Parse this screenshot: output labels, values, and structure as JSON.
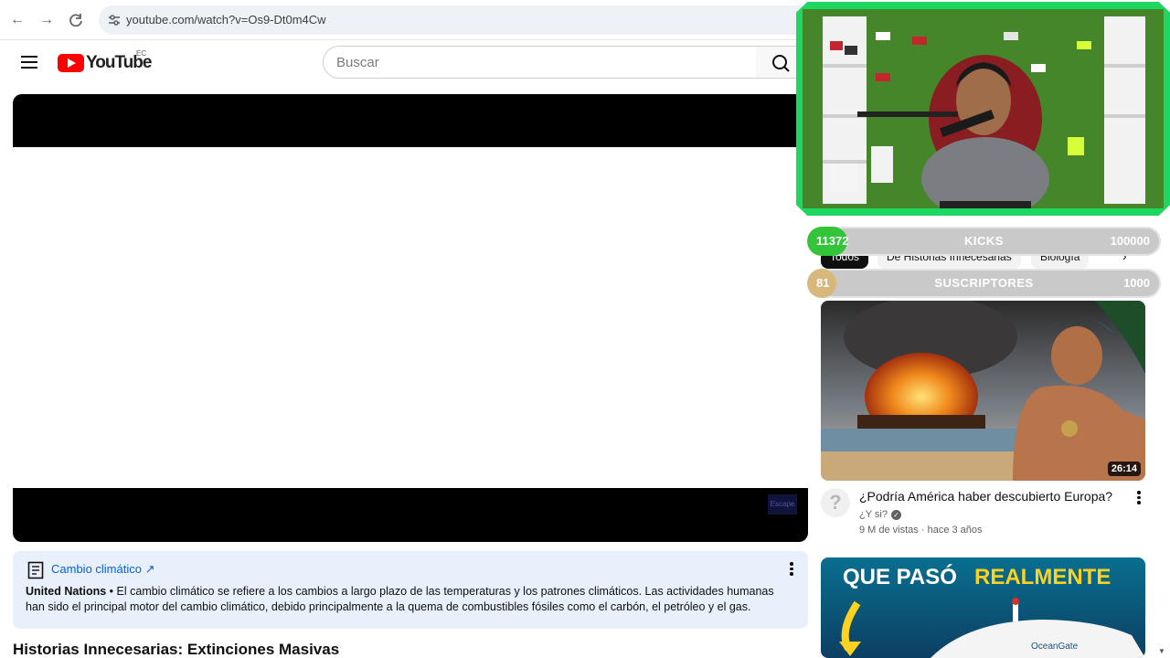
{
  "browser": {
    "url": "youtube.com/watch?v=Os9-Dt0m4Cw"
  },
  "header": {
    "logo_text": "YouTube",
    "country_code": "EC",
    "search_placeholder": "Buscar"
  },
  "player": {
    "watermark": "Escape"
  },
  "info_panel": {
    "topic": "Cambio climático",
    "source": "United Nations",
    "separator": " • ",
    "text": "El cambio climático se refiere a los cambios a largo plazo de las temperaturas y los patrones climáticos. Las actividades humanas han sido el principal motor del cambio climático, debido principalmente a la quema de combustibles fósiles como el carbón, el petróleo y el gas."
  },
  "video": {
    "title": "Historias Innecesarias: Extinciones Masivas"
  },
  "chips": [
    "Todos",
    "De Historias Innecesarias",
    "Biología"
  ],
  "overlay": {
    "kicks": {
      "current": "11372",
      "label": "KICKS",
      "target": "100000",
      "progress": 0.11372
    },
    "subs": {
      "current": "81",
      "label": "SUSCRIPTORES",
      "target": "1000",
      "progress": 0.081
    }
  },
  "recommendations": [
    {
      "title": "¿Podría América haber descubierto Europa?",
      "channel": "¿Y si?",
      "verified": true,
      "meta": "9 M de vistas · hace 3 años",
      "duration": "26:14",
      "avatar_char": "?"
    },
    {
      "thumbnail_text_white": "QUE PASÓ",
      "thumbnail_text_yellow": "REALMENTE",
      "thumbnail_logo": "OceanGate"
    }
  ]
}
